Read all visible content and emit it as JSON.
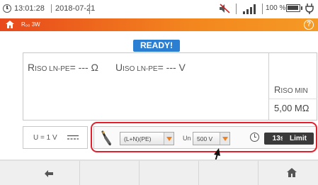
{
  "status": {
    "time": "13:01:28",
    "date": "2018-07-21",
    "battery_percent": "100 %"
  },
  "titlebar": {
    "title": "R₀₀ 3W",
    "help": "?"
  },
  "state": {
    "ready": "READY!"
  },
  "result": {
    "riso_main": "R",
    "riso_sub": "ISO LN-PE",
    "riso_value": "= --- Ω",
    "uiso_main": "U",
    "uiso_sub": "ISO LN-PE",
    "uiso_value": "= --- V",
    "rmin_main": "R",
    "rmin_sub": "ISO MIN",
    "rmin_value": "5,00 MΩ"
  },
  "voltage_box": {
    "label": "U = 1 V"
  },
  "params": {
    "circuit_select": "(L+N)(PE)",
    "un_label": "Un",
    "un_select": "500 V",
    "time_button": "13s",
    "limit_button": "Limit"
  },
  "colors": {
    "accent_orange": "#f08020",
    "ready_blue": "#2b7fd3",
    "highlight_red": "#e3202c"
  }
}
